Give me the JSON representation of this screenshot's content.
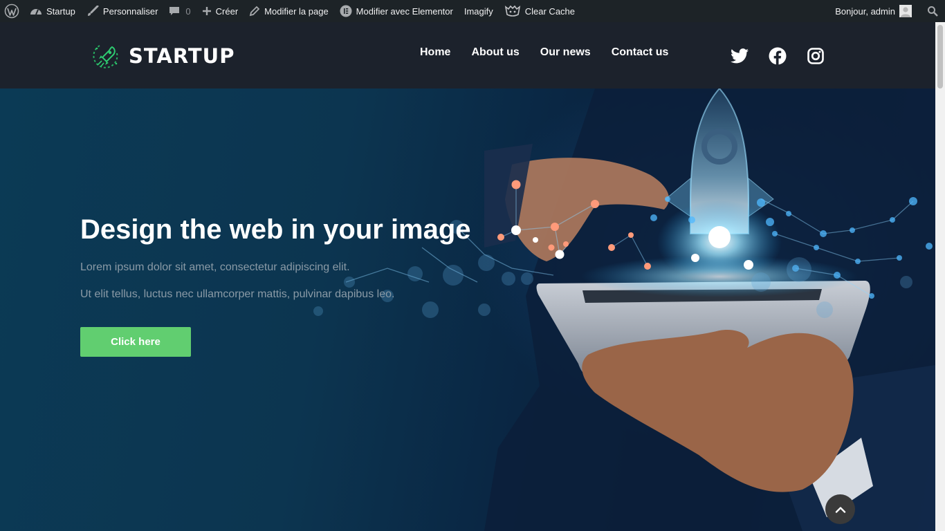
{
  "adminbar": {
    "wp_icon": "wordpress-logo-icon",
    "items": [
      {
        "icon": "dashboard-icon",
        "label": "Startup"
      },
      {
        "icon": "paintbrush-icon",
        "label": "Personnaliser"
      },
      {
        "icon": "comment-icon",
        "label": "",
        "count": "0"
      },
      {
        "icon": "plus-icon",
        "label": "Créer"
      },
      {
        "icon": "pencil-icon",
        "label": "Modifier la page"
      },
      {
        "icon": "elementor-icon",
        "label": "Modifier avec Elementor"
      },
      {
        "icon": "",
        "label": "Imagify"
      },
      {
        "icon": "cache-plugin-icon",
        "label": "Clear Cache"
      }
    ],
    "greeting": "Bonjour, admin",
    "search_icon": "search-icon"
  },
  "header": {
    "logo_text": "STARTUP",
    "logo_icon": "rocket-logo-icon",
    "nav": [
      "Home",
      "About us",
      "Our news",
      "Contact us"
    ],
    "social": [
      "twitter-icon",
      "facebook-icon",
      "instagram-icon"
    ]
  },
  "hero": {
    "title": "Design the web in your image",
    "line1": "Lorem ipsum dolor sit amet, consectetur adipiscing elit.",
    "line2": "Ut elit tellus, luctus nec ullamcorper mattis, pulvinar dapibus leo.",
    "cta_label": "Click here"
  },
  "colors": {
    "adminbar_bg": "#1d2327",
    "header_bg": "#1c222c",
    "cta_bg": "#61ce70",
    "logo_accent": "#2ecc71"
  },
  "back_to_top_icon": "chevron-up-icon"
}
